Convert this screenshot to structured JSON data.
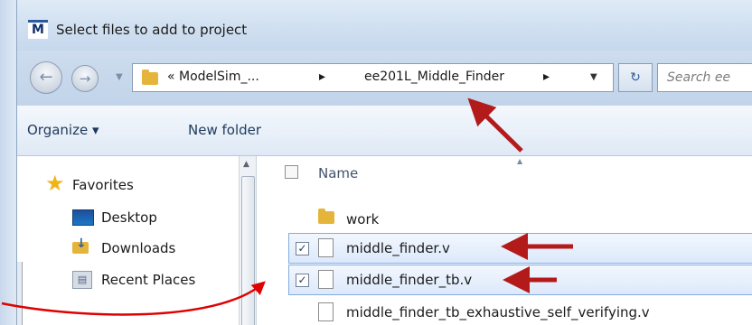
{
  "window": {
    "app_logo": "M",
    "title": "Select files to add to project"
  },
  "address_bar": {
    "crumbs": [
      "« ModelSim_...",
      "▸",
      "ee201L_Middle_Finder",
      "▸"
    ],
    "search_placeholder": "Search ee"
  },
  "toolbar": {
    "organize_label": "Organize ▾",
    "new_folder_label": "New folder"
  },
  "nav_pane": {
    "items": [
      {
        "label": "Favorites",
        "icon": "star-icon"
      },
      {
        "label": "Desktop",
        "icon": "desktop-icon"
      },
      {
        "label": "Downloads",
        "icon": "downloads-icon"
      },
      {
        "label": "Recent Places",
        "icon": "recent-places-icon"
      }
    ]
  },
  "file_list": {
    "column_header": "Name",
    "rows": [
      {
        "name": "work",
        "type": "folder",
        "checked": false
      },
      {
        "name": "middle_finder.v",
        "type": "file",
        "checked": true
      },
      {
        "name": "middle_finder_tb.v",
        "type": "file",
        "checked": true
      },
      {
        "name": "middle_finder_tb_exhaustive_self_verifying.v",
        "type": "file",
        "checked": false
      }
    ]
  },
  "colors": {
    "arrow_dark_red": "#b31b1b",
    "arrow_bright_red": "#e00000",
    "selection_border": "#84acdd",
    "folder": "#e5b43a"
  }
}
